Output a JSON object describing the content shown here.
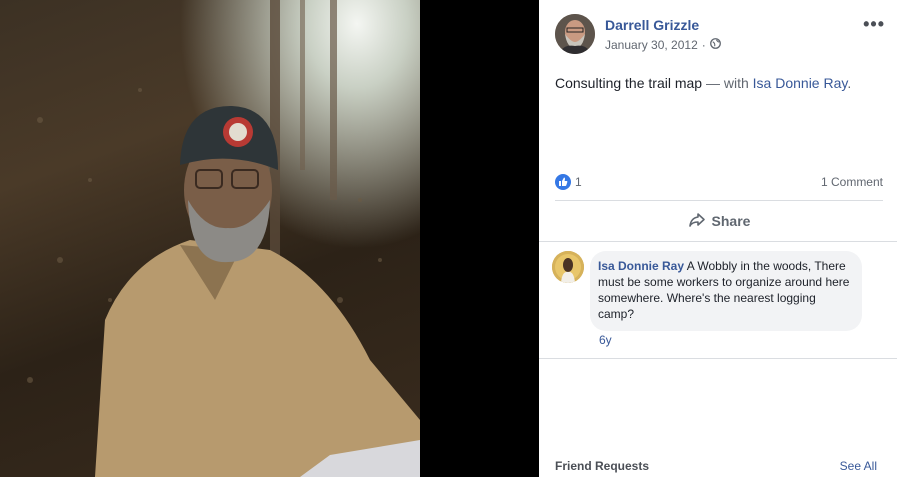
{
  "post": {
    "author": "Darrell Grizzle",
    "date": "January 30, 2012",
    "separator": "·",
    "text": "Consulting the trail map",
    "with_text": "— with",
    "tagged": "Isa Donnie Ray",
    "tagged_end": ".",
    "more": "•••"
  },
  "stats": {
    "likes": "1",
    "comments": "1 Comment"
  },
  "actions": {
    "share_label": "Share"
  },
  "comment": {
    "author": "Isa Donnie Ray",
    "text": "A Wobbly in the woods, There must be some workers to organize around here somewhere. Where's the nearest logging camp?",
    "time": "6y"
  },
  "sidebar": {
    "friend_requests": "Friend Requests",
    "see_all": "See All"
  },
  "colors": {
    "link": "#385898",
    "like": "#3578e5"
  },
  "icons": [
    "globe-icon",
    "like-icon",
    "share-icon",
    "more-icon"
  ]
}
